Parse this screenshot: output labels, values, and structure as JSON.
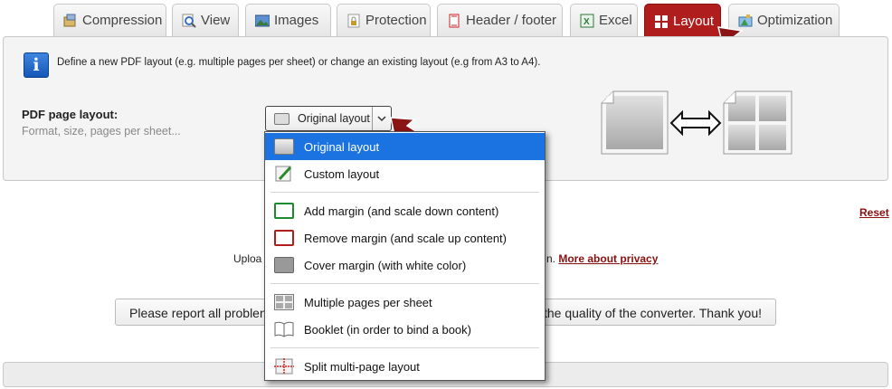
{
  "tabs": [
    {
      "label": "Compression",
      "icon": "compression-icon",
      "active": false
    },
    {
      "label": "View",
      "icon": "view-icon",
      "active": false
    },
    {
      "label": "Images",
      "icon": "images-icon",
      "active": false
    },
    {
      "label": "Protection",
      "icon": "protection-icon",
      "active": false
    },
    {
      "label": "Header / footer",
      "icon": "header-footer-icon",
      "active": false
    },
    {
      "label": "Excel",
      "icon": "excel-icon",
      "active": false
    },
    {
      "label": "Layout",
      "icon": "layout-icon",
      "active": true
    },
    {
      "label": "Optimization",
      "icon": "optimization-icon",
      "active": false
    }
  ],
  "panel": {
    "info_text": "Define a new PDF layout (e.g. multiple pages per sheet) or change an existing layout (e.g from A3 to A4).",
    "field_label": "PDF page layout:",
    "field_sub": "Format, size, pages per sheet...",
    "select_value": "Original layout"
  },
  "dropdown": {
    "options": [
      {
        "label": "Original layout",
        "icon": "original-layout-icon",
        "selected": true
      },
      {
        "label": "Custom layout",
        "icon": "custom-layout-icon",
        "selected": false
      },
      {
        "label": "Add margin (and scale down content)",
        "icon": "add-margin-icon",
        "selected": false
      },
      {
        "label": "Remove margin (and scale up content)",
        "icon": "remove-margin-icon",
        "selected": false
      },
      {
        "label": "Cover margin (with white color)",
        "icon": "cover-margin-icon",
        "selected": false
      },
      {
        "label": "Multiple pages per sheet",
        "icon": "multiple-pages-icon",
        "selected": false
      },
      {
        "label": "Booklet (in order to bind a book)",
        "icon": "booklet-icon",
        "selected": false
      },
      {
        "label": "Split multi-page layout",
        "icon": "split-layout-icon",
        "selected": false
      }
    ]
  },
  "reset_label": "Reset",
  "upload_partial": "Uploa",
  "privacy_partial": "n.",
  "privacy_link": "More about privacy",
  "report_left": "Please report all problen",
  "report_right": "the quality of the converter. Thank you!",
  "colors": {
    "accent_red": "#b01d1d",
    "link_red": "#8a1010",
    "selection_blue": "#1a73e0",
    "arrow_red": "#8b1414"
  }
}
